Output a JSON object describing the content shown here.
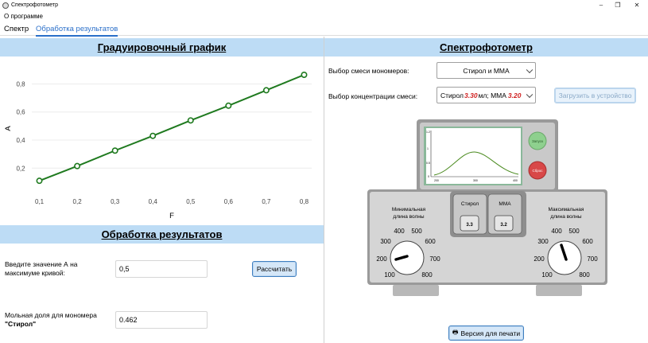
{
  "window": {
    "title": "Спектрофотометр"
  },
  "menu": {
    "about": "О программе"
  },
  "tabs": [
    {
      "label": "Спектр"
    },
    {
      "label": "Обработка результатов"
    }
  ],
  "calibration": {
    "title": "Градуировочный график",
    "chart_data": {
      "type": "line",
      "title": "Градуировочный график",
      "xlabel": "F",
      "ylabel": "A",
      "x": [
        0.1,
        0.2,
        0.3,
        0.4,
        0.5,
        0.6,
        0.7,
        0.8
      ],
      "y": [
        0.11,
        0.215,
        0.325,
        0.43,
        0.54,
        0.645,
        0.755,
        0.865
      ],
      "xlim": [
        0.08,
        0.82
      ],
      "ylim": [
        0.06,
        0.95
      ],
      "x_ticks": [
        "0,1",
        "0,2",
        "0,3",
        "0,4",
        "0,5",
        "0,6",
        "0,7",
        "0,8"
      ],
      "y_ticks": [
        "0,2",
        "0,4",
        "0,6",
        "0,8"
      ],
      "y_tick_values": [
        0.2,
        0.4,
        0.6,
        0.8
      ],
      "grid": "horizontal",
      "color": "#1f7a1f"
    }
  },
  "processing": {
    "title": "Обработка результатов",
    "input_label_1": "Введите значение А на",
    "input_label_2": "максимуме кривой:",
    "input_value": "0,5",
    "calc_button": "Рассчитать",
    "result_label_1": "Мольная доля для мономера",
    "result_label_2": "\"Стирол\"",
    "result_value": "0.462"
  },
  "spectro": {
    "title": "Спектрофотометр",
    "mix_label": "Выбор смеси мономеров:",
    "mix_value": "Стирол и ММА",
    "conc_label": "Выбор концентрации смеси:",
    "conc_prefix": "Стирол ",
    "conc_val1": "3.30",
    "conc_mid": " мл; ММА ",
    "conc_val2": "3.20",
    "load_button": "Загрузить в устройство",
    "print_button": "Версия для печати"
  },
  "device": {
    "screen_y_ticks": [
      "1.2",
      "1",
      "0.5",
      "0"
    ],
    "screen_x_ticks": [
      "200",
      "300",
      "400"
    ],
    "start_button": "Запуск",
    "reset_button": "Сброс",
    "left_knob_label_1": "Минимальная",
    "left_knob_label_2": "длина волны",
    "right_knob_label_1": "Максимальная",
    "right_knob_label_2": "длина волны",
    "monomer1": "Стирол",
    "monomer1_value": "3.3",
    "monomer2": "ММА",
    "monomer2_value": "3.2",
    "scale": [
      "100",
      "200",
      "300",
      "400",
      "500",
      "600",
      "700",
      "800"
    ]
  }
}
